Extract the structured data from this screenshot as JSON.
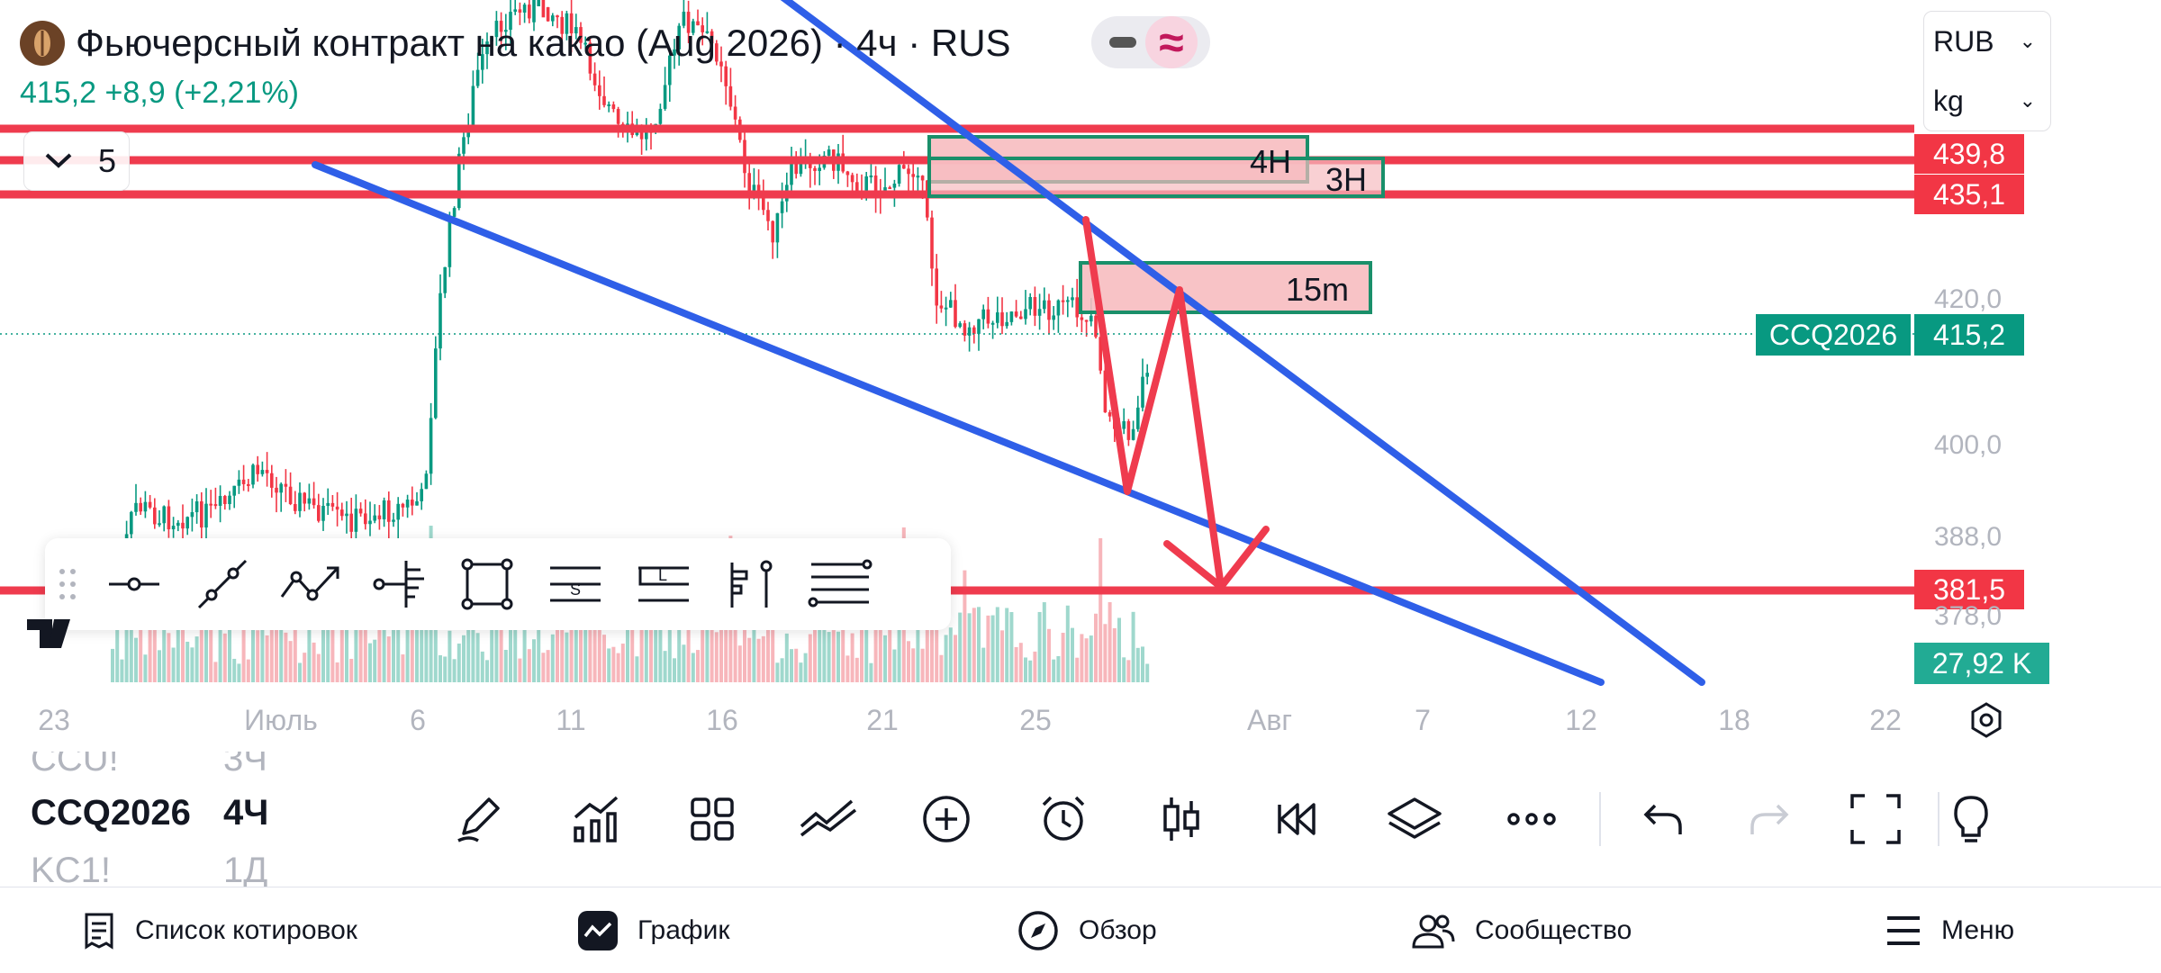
{
  "header": {
    "title": "Фьючерсный контракт на какао (Aug 2026) · 4ч · RUS",
    "price_line": "415,2  +8,9 (+2,21%)",
    "indicator_count": "5",
    "currency": "RUB",
    "unit": "kg",
    "icons": [
      "cocoa-icon",
      "chevron-down-icon",
      "wave-icon"
    ]
  },
  "price_axis": {
    "tags": {
      "line1": "439,8",
      "line2": "435,1",
      "line3": "381,5",
      "last_symbol": "CCQ2026",
      "last_price": "415,2",
      "volume": "27,92 K"
    },
    "labels": [
      "420,0",
      "400,0",
      "388,0",
      "378,0"
    ]
  },
  "zones": {
    "z4h": "4H",
    "z3h": "3H",
    "z15m": "15m"
  },
  "date_axis": [
    "23",
    "Июль",
    "6",
    "11",
    "16",
    "21",
    "25",
    "Авг",
    "7",
    "12",
    "18",
    "22"
  ],
  "drawing_toolbar": {
    "tools": [
      "horizontal-ray",
      "trend-line",
      "path",
      "anchored-vwap",
      "rectangle",
      "long-short-position",
      "long-position",
      "price-range",
      "fib-lines"
    ]
  },
  "watchlist": [
    {
      "symbol": "CCU!",
      "tf": "3Ч",
      "active": false
    },
    {
      "symbol": "CCQ2026",
      "tf": "4Ч",
      "active": true
    },
    {
      "symbol": "KC1!",
      "tf": "1Д",
      "active": false
    }
  ],
  "bottom_toolbar": {
    "tools": [
      "pencil-icon",
      "indicators-icon",
      "grid-icon",
      "compare-icon",
      "add-icon",
      "alert-icon",
      "candles-icon",
      "replay-icon",
      "layers-icon",
      "more-icon",
      "undo-icon",
      "redo-icon",
      "fullscreen-icon",
      "idea-icon"
    ]
  },
  "nav": {
    "watchlist": "Список котировок",
    "chart": "График",
    "overview": "Обзор",
    "community": "Сообщество",
    "menu": "Меню"
  },
  "colors": {
    "up": "#089981",
    "down": "#f23645",
    "trendline": "#2f5fe8",
    "zone_fill": "#f7bcc0",
    "zone_border": "#1a8f6a"
  }
}
